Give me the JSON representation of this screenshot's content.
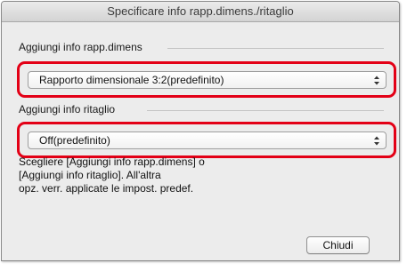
{
  "window": {
    "title": "Specificare info rapp.dimens./ritaglio"
  },
  "aspect_group": {
    "label": "Aggiungi info rapp.dimens",
    "select_value": "Rapporto dimensionale 3:2(predefinito)"
  },
  "crop_group": {
    "label": "Aggiungi info ritaglio",
    "select_value": "Off(predefinito)"
  },
  "description": {
    "line1": "Scegliere [Aggiungi info rapp.dimens] o",
    "line2": "[Aggiungi info ritaglio]. All'altra",
    "line3": "opz. verr. applicate le impost. predef."
  },
  "buttons": {
    "close_label": "Chiudi"
  },
  "colors": {
    "highlight": "#e30016",
    "window_bg": "#ececec"
  }
}
